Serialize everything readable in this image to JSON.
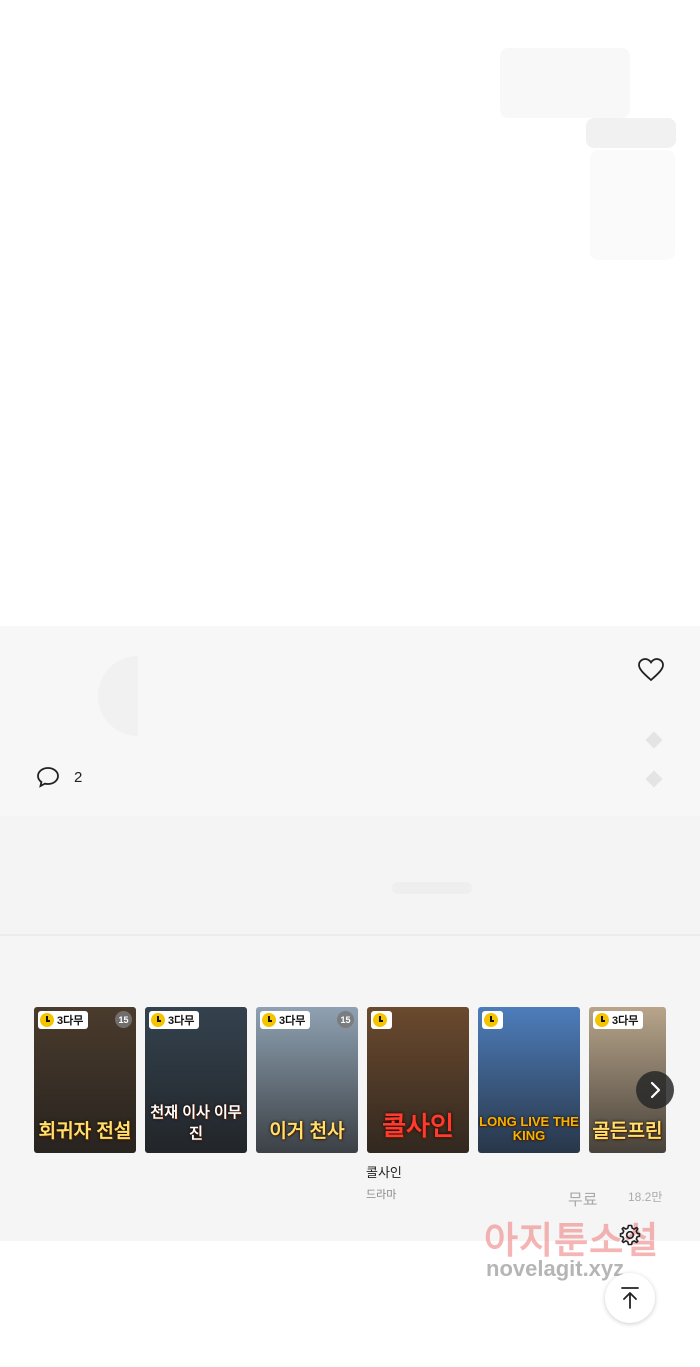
{
  "interaction": {
    "comment_count": "2"
  },
  "recommendations": {
    "cards": [
      {
        "badge": "3다무",
        "age": "15",
        "cover_title": "회귀자 전설",
        "bg": "#4a3b2c"
      },
      {
        "badge": "3다무",
        "age": "",
        "cover_title": "천재 이사 이무진",
        "bg": "#34424e"
      },
      {
        "badge": "3다무",
        "age": "15",
        "cover_title": "이거 천사",
        "bg": "#8fa1b2"
      },
      {
        "badge": "",
        "age": "",
        "cover_title": "콜사인",
        "bg": "#6b4a2e"
      },
      {
        "badge": "",
        "age": "",
        "cover_title": "LONG LIVE THE KING",
        "bg": "#4d7dbb"
      },
      {
        "badge": "3다무",
        "age": "",
        "cover_title": "골든프린",
        "bg": "#b8a58b"
      }
    ],
    "featured_title": "콜사인",
    "featured_genre": "드라마"
  },
  "ad": {
    "faint_top": "무료",
    "faint_right": "18.2만"
  },
  "watermark": {
    "korean": "아지툰소설",
    "english": "novelagit.xyz"
  },
  "icons": {
    "heart": "heart-icon",
    "comment": "comment-icon",
    "next": "chevron-right-icon",
    "settings": "gear-icon",
    "scroll_top": "arrow-up-icon"
  }
}
